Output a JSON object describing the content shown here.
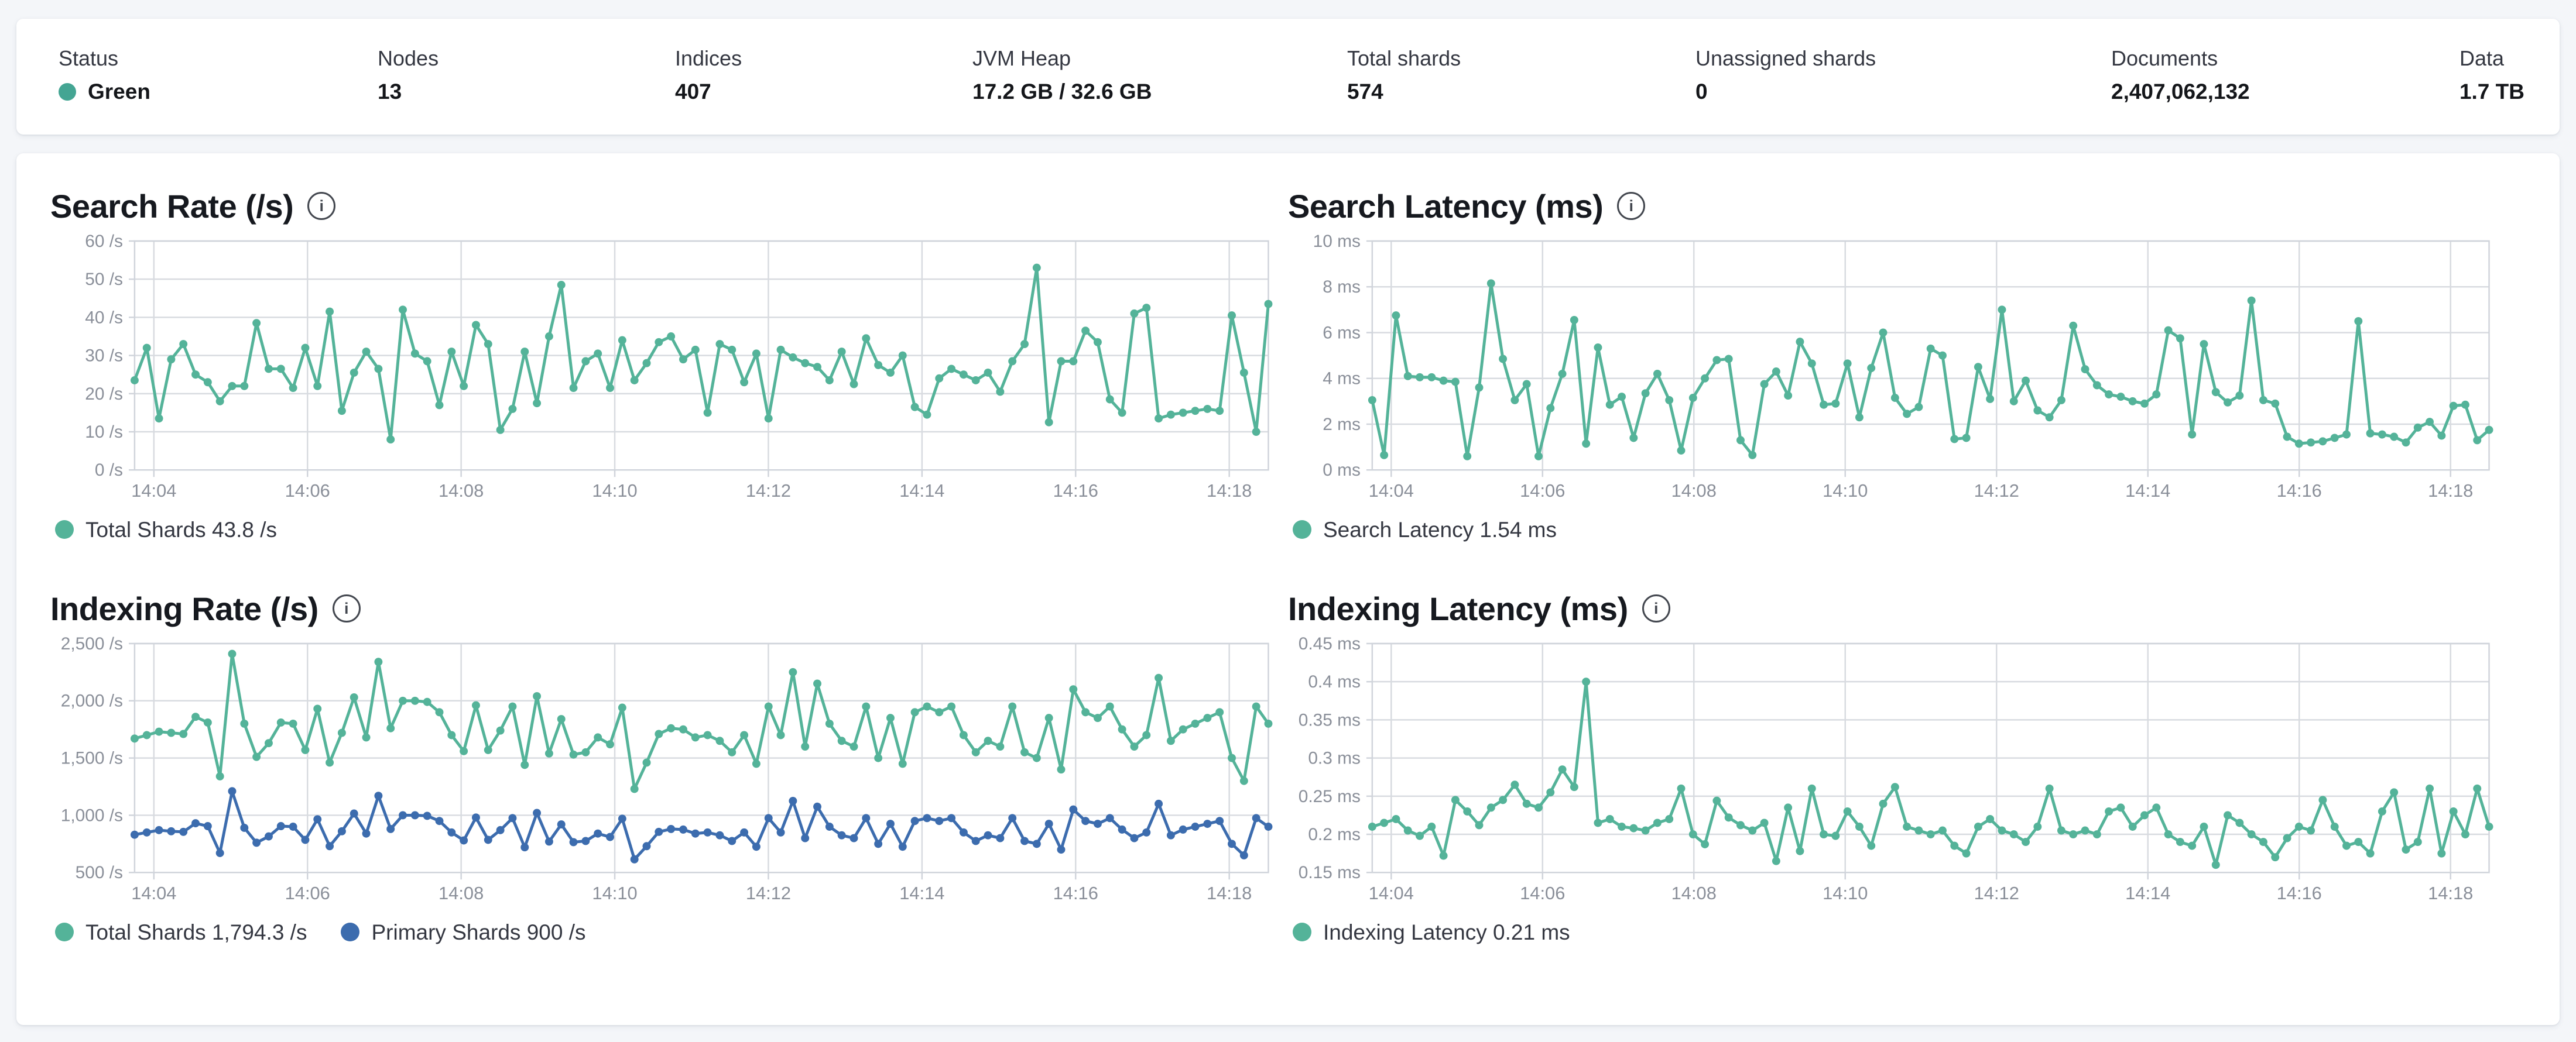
{
  "colors": {
    "teal_series": "#54b399",
    "blue_series": "#3c6cae",
    "health_green_dot": "#44a593",
    "grid_line": "#d8dbe0",
    "plot_border": "#d0d4db",
    "axis_text": "#8a8f99"
  },
  "status_bar": {
    "items": [
      {
        "label": "Status",
        "value": "Green",
        "health_dot": true
      },
      {
        "label": "Nodes",
        "value": "13"
      },
      {
        "label": "Indices",
        "value": "407"
      },
      {
        "label": "JVM Heap",
        "value": "17.2 GB / 32.6 GB"
      },
      {
        "label": "Total shards",
        "value": "574"
      },
      {
        "label": "Unassigned shards",
        "value": "0"
      },
      {
        "label": "Documents",
        "value": "2,407,062,132"
      },
      {
        "label": "Data",
        "value": "1.7 TB"
      }
    ]
  },
  "chart_data": [
    {
      "type": "line",
      "title": "Search Rate (/s)",
      "ylim": [
        0,
        60
      ],
      "grid": true,
      "legend_position": "bottom",
      "y_ticks": {
        "values": [
          0,
          10,
          20,
          30,
          40,
          50,
          60
        ],
        "labels": [
          "0 /s",
          "10 /s",
          "20 /s",
          "30 /s",
          "40 /s",
          "50 /s",
          "60 /s"
        ]
      },
      "x_ticks": [
        "14:04",
        "14:06",
        "14:08",
        "14:10",
        "14:12",
        "14:14",
        "14:16",
        "14:18"
      ],
      "legend": [
        {
          "label": "Total Shards 43.8 /s",
          "color": "#54b399"
        }
      ],
      "series": [
        {
          "name": "Total Shards",
          "color": "#54b399",
          "values": [
            23.5,
            32,
            13.5,
            29,
            33,
            25,
            23,
            18,
            22,
            22,
            38.5,
            26.5,
            26.5,
            21.5,
            32,
            22,
            41.5,
            15.5,
            25.5,
            31,
            26.5,
            8,
            42,
            30.5,
            28.5,
            17,
            31,
            22,
            38,
            33,
            10.5,
            16,
            31,
            17.5,
            35,
            48.5,
            21.5,
            28.5,
            30.5,
            21.5,
            34,
            23.5,
            28,
            33.5,
            35,
            29,
            31.5,
            15,
            33,
            31.5,
            23,
            30.5,
            13.5,
            31.5,
            29.5,
            28,
            27,
            23.5,
            31,
            22.5,
            34.5,
            27.5,
            25.5,
            30,
            16.5,
            14.5,
            24,
            26.5,
            25,
            23.5,
            25.5,
            20.5,
            28.5,
            33,
            53,
            12.5,
            28.5,
            28.5,
            36.5,
            33.5,
            18.5,
            15,
            41,
            42.5,
            13.5,
            14.5,
            15,
            15.5,
            16,
            15.5,
            40.5,
            25.5,
            10,
            43.5
          ]
        }
      ]
    },
    {
      "type": "line",
      "title": "Search Latency (ms)",
      "ylim": [
        0,
        10
      ],
      "grid": true,
      "legend_position": "bottom",
      "y_ticks": {
        "values": [
          0,
          2,
          4,
          6,
          8,
          10
        ],
        "labels": [
          "0 ms",
          "2 ms",
          "4 ms",
          "6 ms",
          "8 ms",
          "10 ms"
        ]
      },
      "x_ticks": [
        "14:04",
        "14:06",
        "14:08",
        "14:10",
        "14:12",
        "14:14",
        "14:16",
        "14:18"
      ],
      "legend": [
        {
          "label": "Search Latency 1.54 ms",
          "color": "#54b399"
        }
      ],
      "series": [
        {
          "name": "Search Latency",
          "color": "#54b399",
          "values": [
            3.05,
            0.65,
            6.75,
            4.1,
            4.05,
            4.05,
            3.9,
            3.85,
            0.6,
            3.6,
            8.15,
            4.85,
            3.05,
            3.75,
            0.6,
            2.7,
            4.2,
            6.55,
            1.15,
            5.35,
            2.85,
            3.2,
            1.4,
            3.35,
            4.2,
            3.05,
            0.85,
            3.15,
            4.0,
            4.8,
            4.85,
            1.3,
            0.65,
            3.75,
            4.3,
            3.25,
            5.6,
            4.65,
            2.85,
            2.9,
            4.65,
            2.3,
            4.45,
            6.0,
            3.15,
            2.45,
            2.75,
            5.3,
            5.0,
            1.35,
            1.4,
            4.5,
            3.1,
            7.0,
            3.0,
            3.9,
            2.6,
            2.3,
            3.05,
            6.3,
            4.4,
            3.7,
            3.3,
            3.2,
            3.0,
            2.9,
            3.3,
            6.1,
            5.75,
            1.55,
            5.5,
            3.4,
            2.95,
            3.25,
            7.4,
            3.05,
            2.9,
            1.45,
            1.15,
            1.2,
            1.25,
            1.4,
            1.55,
            6.5,
            1.6,
            1.55,
            1.45,
            1.2,
            1.85,
            2.1,
            1.5,
            2.8,
            2.85,
            1.3,
            1.75
          ]
        }
      ]
    },
    {
      "type": "line",
      "title": "Indexing Rate (/s)",
      "ylim": [
        500,
        2500
      ],
      "grid": true,
      "legend_position": "bottom",
      "y_ticks": {
        "values": [
          500,
          1000,
          1500,
          2000,
          2500
        ],
        "labels": [
          "500 /s",
          "1,000 /s",
          "1,500 /s",
          "2,000 /s",
          "2,500 /s"
        ]
      },
      "x_ticks": [
        "14:04",
        "14:06",
        "14:08",
        "14:10",
        "14:12",
        "14:14",
        "14:16",
        "14:18"
      ],
      "legend": [
        {
          "label": "Total Shards 1,794.3 /s",
          "color": "#54b399"
        },
        {
          "label": "Primary Shards 900 /s",
          "color": "#3c6cae"
        }
      ],
      "series": [
        {
          "name": "Total Shards",
          "color": "#54b399",
          "values": [
            1670,
            1700,
            1730,
            1720,
            1710,
            1860,
            1810,
            1340,
            2410,
            1800,
            1510,
            1630,
            1810,
            1800,
            1570,
            1930,
            1460,
            1720,
            2030,
            1680,
            2340,
            1760,
            2000,
            2000,
            1990,
            1900,
            1700,
            1560,
            1960,
            1570,
            1740,
            1950,
            1440,
            2040,
            1540,
            1840,
            1530,
            1550,
            1680,
            1620,
            1940,
            1230,
            1460,
            1710,
            1760,
            1750,
            1680,
            1700,
            1650,
            1550,
            1700,
            1450,
            1950,
            1700,
            2250,
            1600,
            2150,
            1800,
            1650,
            1600,
            1950,
            1500,
            1850,
            1450,
            1900,
            1950,
            1900,
            1950,
            1700,
            1550,
            1650,
            1600,
            1950,
            1550,
            1500,
            1850,
            1400,
            2100,
            1900,
            1850,
            1950,
            1750,
            1600,
            1700,
            2200,
            1650,
            1750,
            1800,
            1850,
            1900,
            1500,
            1300,
            1950,
            1800
          ]
        },
        {
          "name": "Primary Shards",
          "color": "#3c6cae",
          "values": [
            830,
            850,
            870,
            860,
            855,
            930,
            905,
            670,
            1210,
            890,
            760,
            815,
            905,
            900,
            785,
            965,
            730,
            860,
            1015,
            840,
            1170,
            880,
            1000,
            1000,
            995,
            950,
            850,
            780,
            980,
            785,
            870,
            975,
            720,
            1020,
            770,
            920,
            765,
            775,
            840,
            810,
            970,
            615,
            730,
            855,
            880,
            875,
            840,
            850,
            825,
            775,
            850,
            725,
            975,
            850,
            1125,
            800,
            1075,
            900,
            825,
            800,
            975,
            750,
            925,
            725,
            950,
            975,
            950,
            975,
            850,
            775,
            825,
            800,
            975,
            775,
            750,
            925,
            700,
            1050,
            950,
            925,
            975,
            875,
            800,
            850,
            1100,
            825,
            875,
            900,
            925,
            950,
            750,
            650,
            975,
            900
          ]
        }
      ]
    },
    {
      "type": "line",
      "title": "Indexing Latency (ms)",
      "ylim": [
        0.15,
        0.45
      ],
      "grid": true,
      "legend_position": "bottom",
      "y_ticks": {
        "values": [
          0.15,
          0.2,
          0.25,
          0.3,
          0.35,
          0.4,
          0.45
        ],
        "labels": [
          "0.15 ms",
          "0.2 ms",
          "0.25 ms",
          "0.3 ms",
          "0.35 ms",
          "0.4 ms",
          "0.45 ms"
        ]
      },
      "x_ticks": [
        "14:04",
        "14:06",
        "14:08",
        "14:10",
        "14:12",
        "14:14",
        "14:16",
        "14:18"
      ],
      "legend": [
        {
          "label": "Indexing Latency 0.21 ms",
          "color": "#54b399"
        }
      ],
      "series": [
        {
          "name": "Indexing Latency",
          "color": "#54b399",
          "values": [
            0.21,
            0.215,
            0.22,
            0.205,
            0.198,
            0.21,
            0.172,
            0.245,
            0.23,
            0.212,
            0.235,
            0.245,
            0.265,
            0.24,
            0.235,
            0.255,
            0.285,
            0.262,
            0.4,
            0.215,
            0.22,
            0.21,
            0.208,
            0.205,
            0.215,
            0.22,
            0.26,
            0.2,
            0.187,
            0.244,
            0.222,
            0.212,
            0.205,
            0.215,
            0.165,
            0.235,
            0.178,
            0.26,
            0.2,
            0.198,
            0.23,
            0.21,
            0.185,
            0.24,
            0.262,
            0.21,
            0.205,
            0.2,
            0.205,
            0.185,
            0.175,
            0.21,
            0.22,
            0.205,
            0.2,
            0.19,
            0.21,
            0.26,
            0.205,
            0.2,
            0.205,
            0.2,
            0.23,
            0.235,
            0.21,
            0.225,
            0.235,
            0.2,
            0.19,
            0.185,
            0.21,
            0.16,
            0.225,
            0.215,
            0.2,
            0.19,
            0.17,
            0.195,
            0.21,
            0.205,
            0.245,
            0.21,
            0.185,
            0.19,
            0.175,
            0.23,
            0.255,
            0.18,
            0.19,
            0.26,
            0.175,
            0.23,
            0.2,
            0.26,
            0.21
          ]
        }
      ]
    }
  ]
}
